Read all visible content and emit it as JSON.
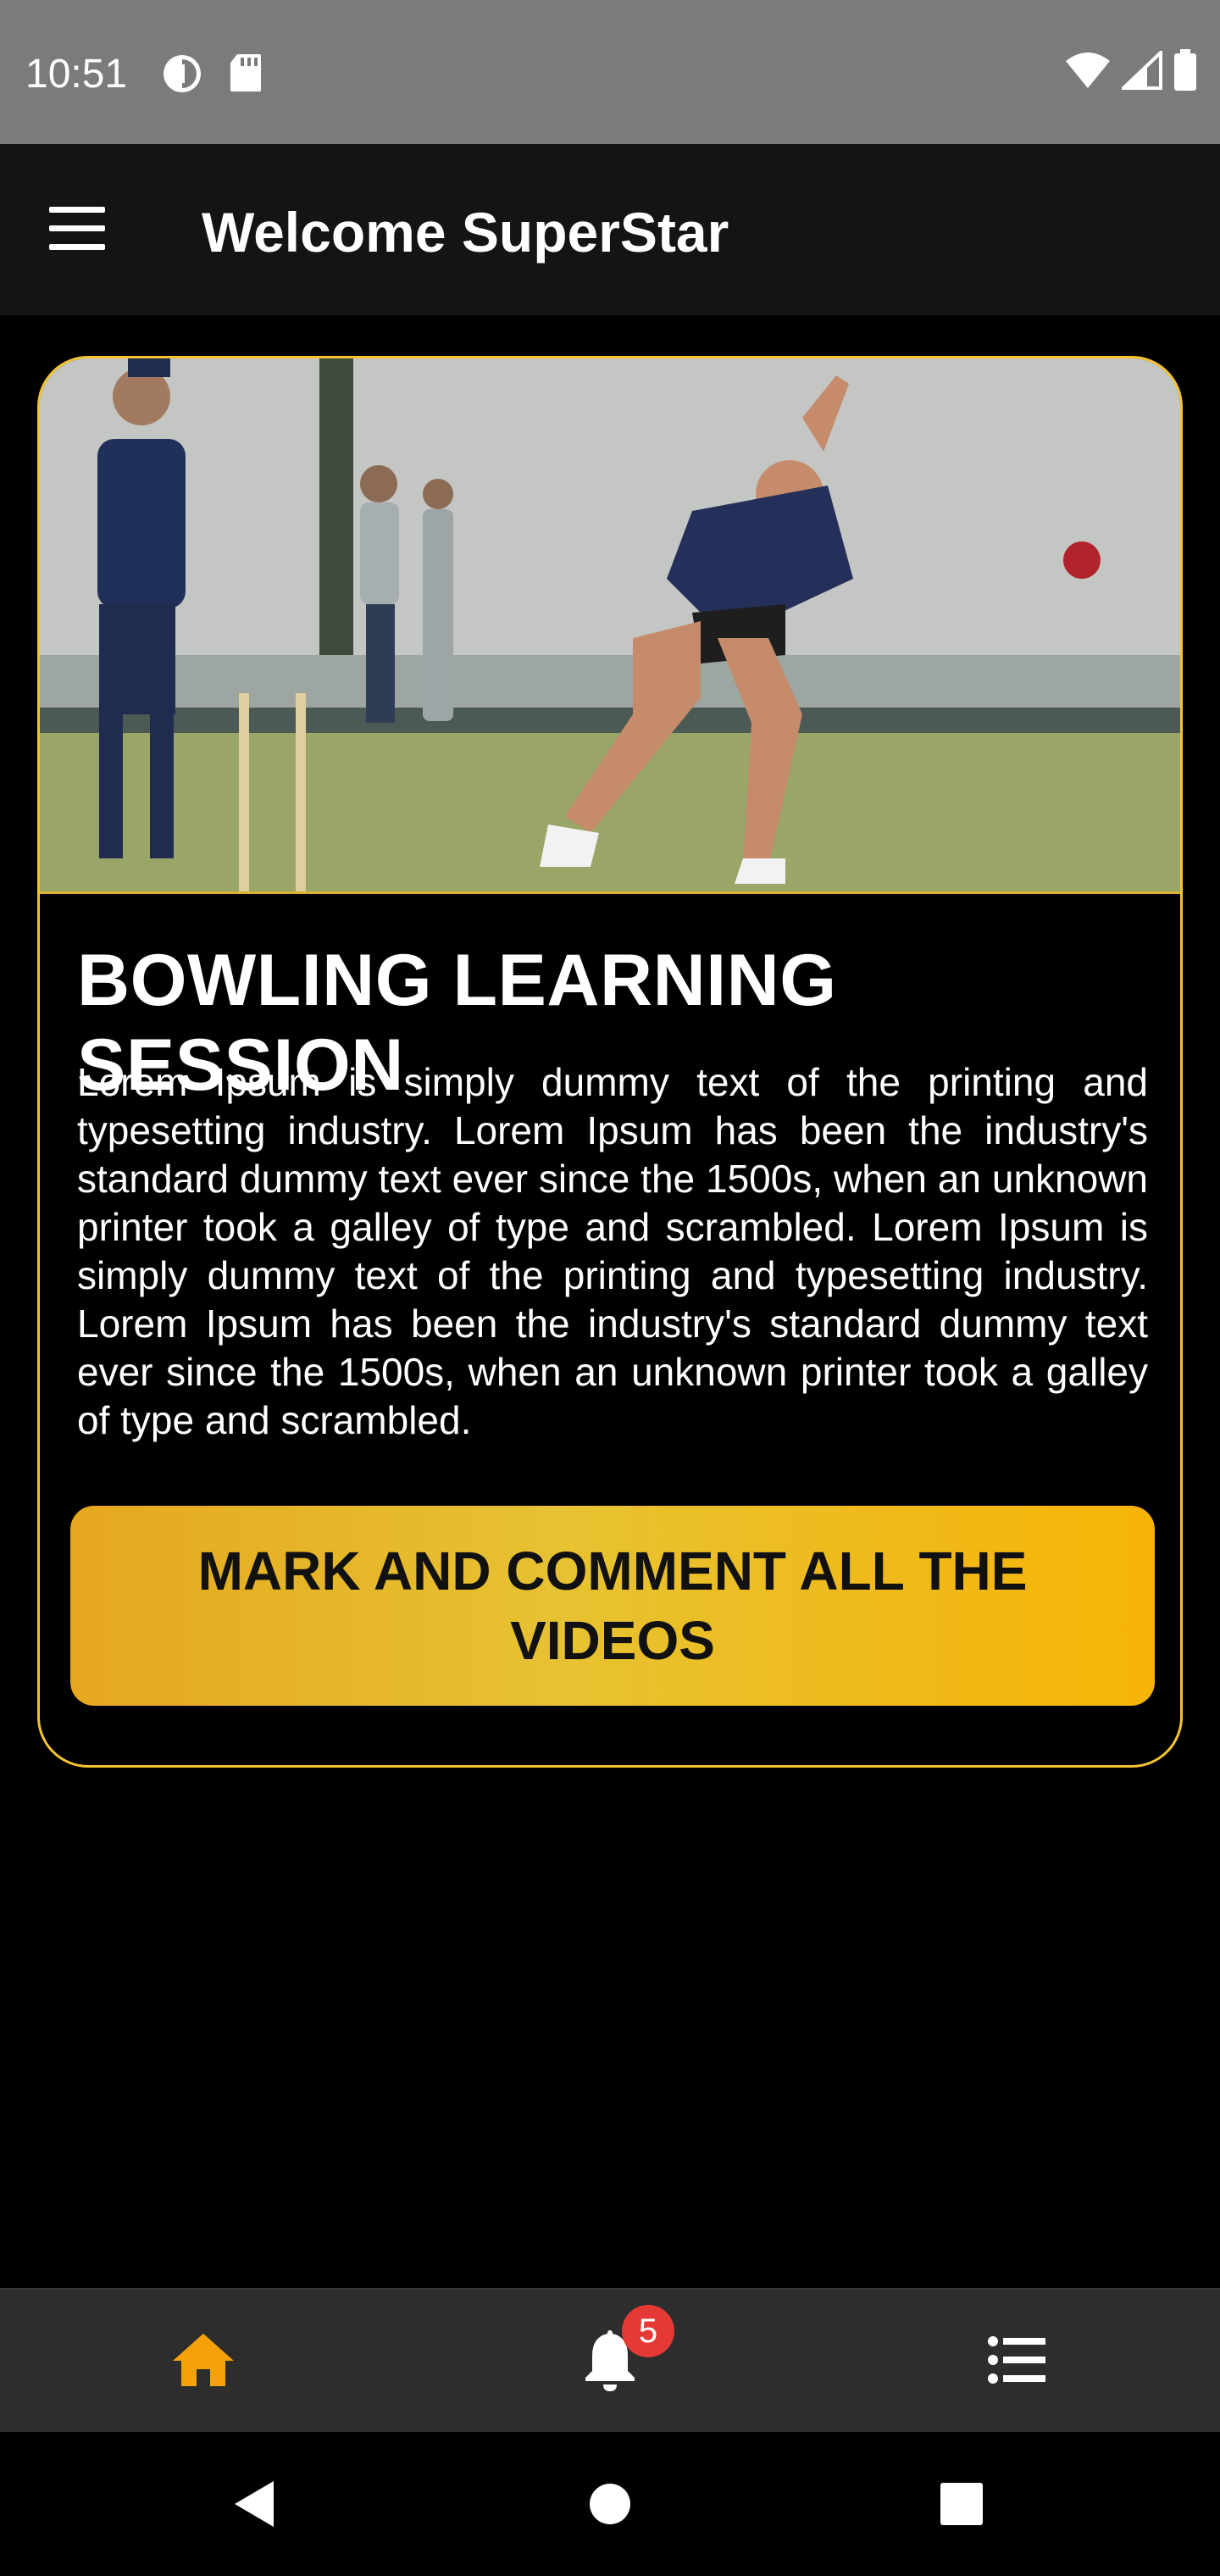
{
  "status_bar": {
    "time": "10:51",
    "left_icons": [
      "data-saver-icon",
      "sd-card-icon"
    ],
    "right_icons": [
      "wifi-icon",
      "cell-signal-icon",
      "battery-icon"
    ]
  },
  "app_bar": {
    "title": "Welcome SuperStar",
    "menu_icon": "hamburger-menu-icon"
  },
  "card": {
    "image_alt": "cricket-bowler-photo",
    "title": "BOWLING LEARNING SESSION",
    "body": "Lorem Ipsum is simply dummy text of the printing and typesetting industry. Lorem Ipsum has been the industry's standard dummy text ever since the 1500s, when an unknown printer took a galley of type and scrambled. Lorem Ipsum is simply dummy text of the printing and typesetting industry. Lorem Ipsum has been the industry's standard dummy text ever since the 1500s, when an unknown printer took a galley of type and scrambled.",
    "button_label": "MARK AND COMMENT ALL THE VIDEOS",
    "border_color": "#f4c430"
  },
  "bottom_nav": {
    "items": [
      {
        "icon": "home-icon",
        "active": true,
        "color": "#f5a20a"
      },
      {
        "icon": "bell-icon",
        "badge": "5"
      },
      {
        "icon": "list-icon"
      }
    ]
  },
  "system_nav": {
    "buttons": [
      "back-icon",
      "home-circle-icon",
      "recents-icon"
    ]
  }
}
